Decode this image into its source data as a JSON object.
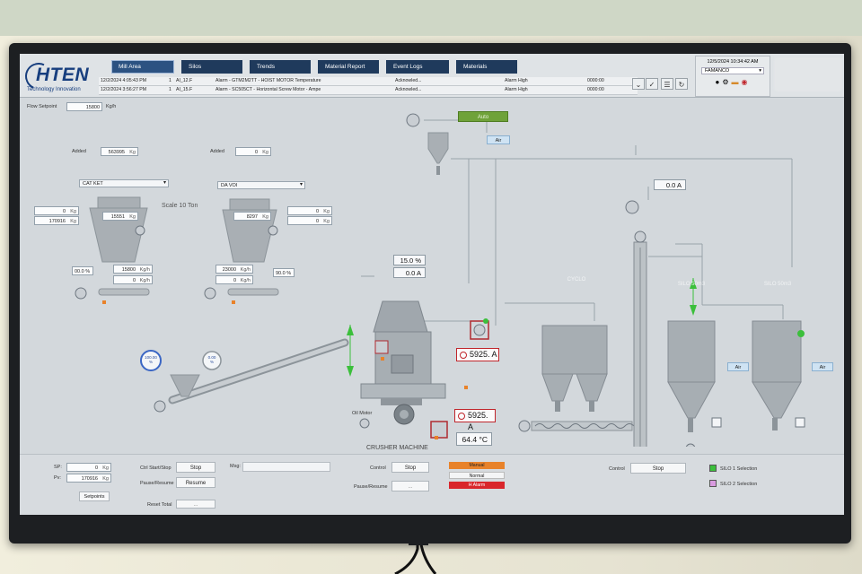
{
  "nav": {
    "tabs": [
      {
        "label": "Mill Area",
        "active": true
      },
      {
        "label": "Silos"
      },
      {
        "label": "Trends"
      },
      {
        "label": "Material Report"
      },
      {
        "label": "Event Logs"
      },
      {
        "label": "Materials"
      }
    ]
  },
  "logo": {
    "name": "HTEN",
    "tagline": "Technology Innovation"
  },
  "alarms": [
    {
      "time": "12/2/2024 4:05:43 PM",
      "count": "1",
      "tag": "AI_12.F",
      "message": "Alarm - GTM2M2TT - HOIST MOTOR Temperature",
      "state": "Acknowled...",
      "type": "Alarm High",
      "value": "0000:00"
    },
    {
      "time": "12/2/2024 3:56:27 PM",
      "count": "1",
      "tag": "AI_15.F",
      "message": "Alarm - SC505CT - Horizontal Screw Motor - Ampe",
      "state": "Acknowled...",
      "type": "Alarm High",
      "value": "0000:00"
    }
  ],
  "clock": {
    "datetime": "12/5/2024 10:34:42 AM",
    "user": "FAMANCO"
  },
  "main": {
    "flow_setpoint_label": "Flow Setpoint",
    "flow_setpoint_value": "15800",
    "flow_setpoint_unit": "Kg/h",
    "added_label": "Added",
    "left_added": "563995",
    "left_added_unit": "Kg",
    "right_added": "0",
    "right_added_unit": "Kg",
    "left_material": "CAT KET",
    "right_material": "DA VOI",
    "scale_label": "Scale 10 Ton",
    "left_bin_weight": "15551",
    "left_bin_unit": "Kg",
    "right_bin_weight": "8297",
    "right_bin_unit": "Kg",
    "left_set_1": "0",
    "left_set_1_unit": "Kg",
    "left_set_2": "170916",
    "left_set_2_unit": "Kg",
    "right_set_1": "0",
    "right_set_1_unit": "Kg",
    "right_set_2": "0",
    "right_set_2_unit": "Kg",
    "left_pct": "00.0",
    "left_pct_unit": "%",
    "right_pct": "90.0",
    "right_pct_unit": "%",
    "left_flow_1": "15800",
    "left_flow_1_unit": "Kg/h",
    "left_flow_2": "0",
    "left_flow_2_unit": "Kg/h",
    "right_flow_1": "23000",
    "right_flow_1_unit": "Kg/h",
    "right_flow_2": "0",
    "right_flow_2_unit": "Kg/h",
    "gauge_left": "100.00",
    "gauge_left_unit": "%",
    "gauge_right": "0.00",
    "gauge_right_unit": "%",
    "auto_label": "Auto",
    "air_label": "Air",
    "mill_pct": "15.0",
    "mill_pct_unit": "%",
    "mill_current": "0.0",
    "mill_current_unit": "A",
    "fan_current": "5925.",
    "fan_current_unit": "A",
    "motor_current": "5925.",
    "motor_current_unit": "A",
    "oil_temp": "64.4",
    "oil_temp_unit": "°C",
    "oil_motor_label": "Oil Motor",
    "crusher_label": "CRUSHER MACHINE",
    "elevator_current": "0.0",
    "elevator_current_unit": "A",
    "cyclo_label": "CYCLO",
    "silo1_label": "SILO 50m3",
    "silo2_label": "SILO 50m3",
    "silo1_air": "Air",
    "silo2_air": "Air"
  },
  "bottom": {
    "sp_label": "SP:",
    "sp_value": "0",
    "sp_unit": "Kg",
    "pv_label": "Pv:",
    "pv_value": "170916",
    "pv_unit": "Kg",
    "setpoints_btn": "Setpoints",
    "ctrl_label": "Ctrl Start/Stop",
    "stop_btn": "Stop",
    "pause_label": "Pause/Resume",
    "resume_btn": "Resume",
    "reset_label": "Reset Total",
    "reset_btn": "...",
    "msg_label": "Msg:",
    "control_label": "Control",
    "control_stop": "Stop",
    "pause2_label": "Pause/Resume",
    "pause2_btn": "...",
    "status_manual": "Manual",
    "status_normal": "Normal",
    "status_alarm": "H Alarm",
    "control2_label": "Control",
    "control2_stop": "Stop",
    "silo1_sel": "SILO 1 Selection",
    "silo2_sel": "SILO 2 Selection"
  },
  "colors": {
    "nav_bg": "#1f3a5c",
    "alarm_red": "#c0252b",
    "run_green": "#3bbf3b",
    "status_manual": "#e8822a",
    "status_alarm": "#d9262b",
    "auto_green": "#6fa23a"
  }
}
